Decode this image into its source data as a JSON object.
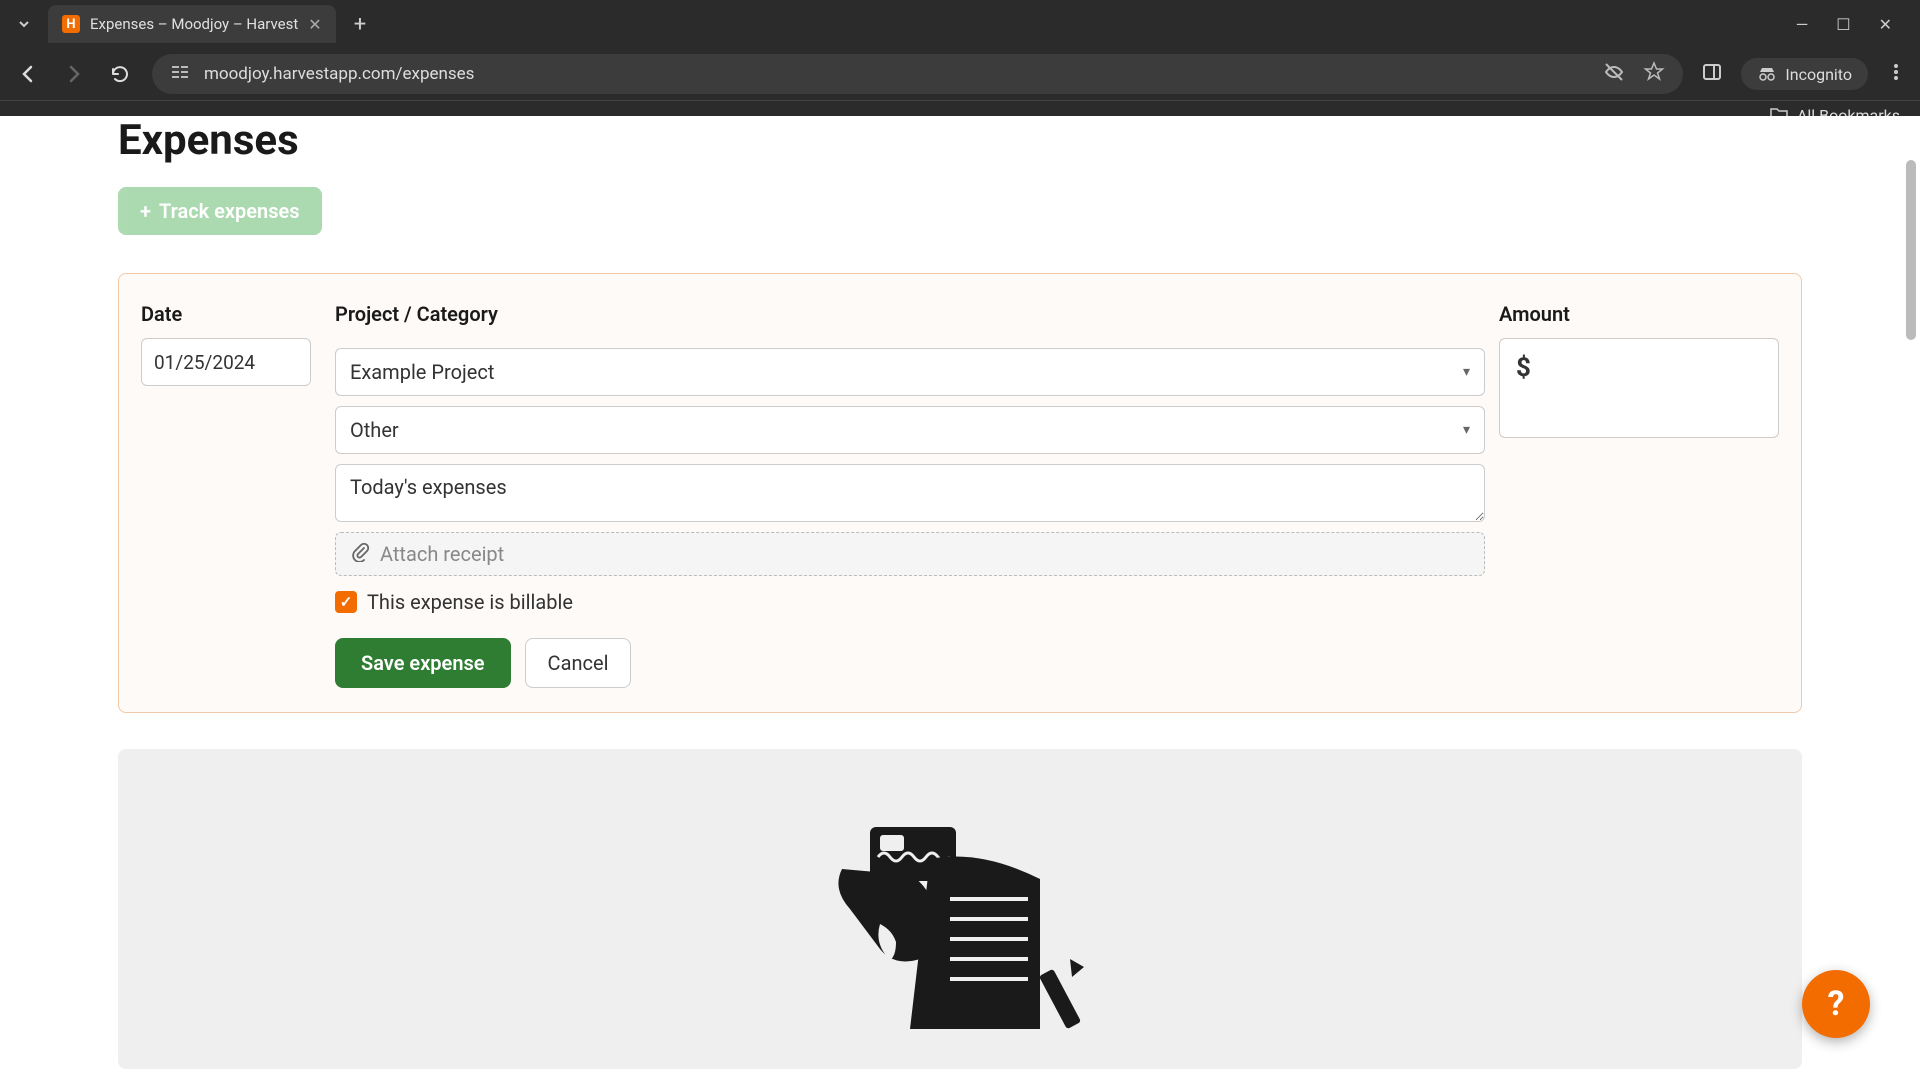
{
  "browser": {
    "tab_title": "Expenses – Moodjoy – Harvest",
    "url": "moodjoy.harvestapp.com/expenses",
    "incognito_label": "Incognito",
    "all_bookmarks_label": "All Bookmarks"
  },
  "page": {
    "title": "Expenses",
    "track_button_label": "Track expenses"
  },
  "form": {
    "date_label": "Date",
    "project_label": "Project / Category",
    "amount_label": "Amount",
    "date_value": "01/25/2024",
    "project_value": "Example Project",
    "category_value": "Other",
    "notes_value": "Today's expenses",
    "attach_label": "Attach receipt",
    "billable_label": "This expense is billable",
    "billable_checked": true,
    "amount_currency": "$",
    "save_label": "Save expense",
    "cancel_label": "Cancel"
  },
  "help_label": "?",
  "colors": {
    "accent_orange": "#f36c00",
    "save_green": "#2e7d32",
    "track_green": "#9dd3a3",
    "card_border": "#f2c9a7"
  }
}
